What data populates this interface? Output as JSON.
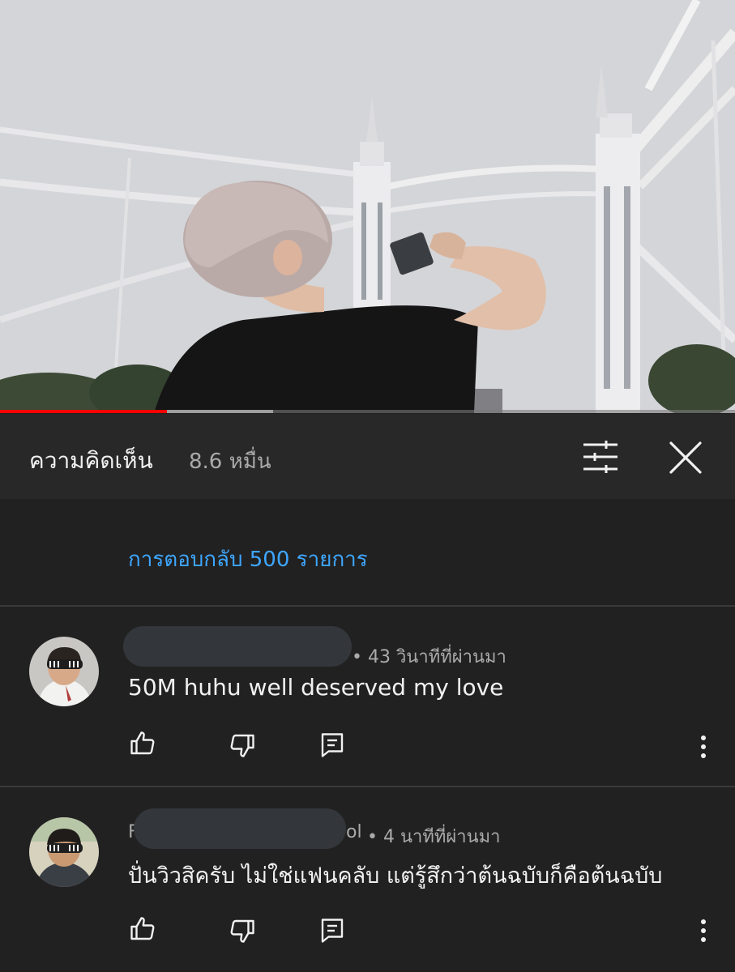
{
  "video": {
    "progress_played": 0.227,
    "progress_buffered": 0.372
  },
  "header": {
    "title": "ความคิดเห็น",
    "count": "8.6 หมื่น",
    "filter_icon": "sliders-icon",
    "close_icon": "close-icon"
  },
  "replies_link": "การตอบกลับ 500 รายการ",
  "comments": [
    {
      "name_prefix": "",
      "name_suffix": "",
      "time": "• 43 วินาทีที่ผ่านมา",
      "text": "50M huhu well deserved my love",
      "actions": [
        "thumb-up-icon",
        "thumb-down-icon",
        "reply-icon",
        "more-vert-icon"
      ]
    },
    {
      "name_prefix": "F",
      "name_suffix": "ol",
      "time": "• 4 นาทีที่ผ่านมา",
      "text": "ปั่นวิวสิครับ ไม่ใช่แฟนคลับ แต่รู้สึกว่าต้นฉบับก็คือต้นฉบับ",
      "actions": [
        "thumb-up-icon",
        "thumb-down-icon",
        "reply-icon",
        "more-vert-icon"
      ]
    }
  ],
  "colors": {
    "background": "#212121",
    "header_bg": "#282828",
    "accent_blue": "#3ea6ff",
    "progress_red": "#ff0000",
    "secondary_text": "#aaaaaa"
  }
}
